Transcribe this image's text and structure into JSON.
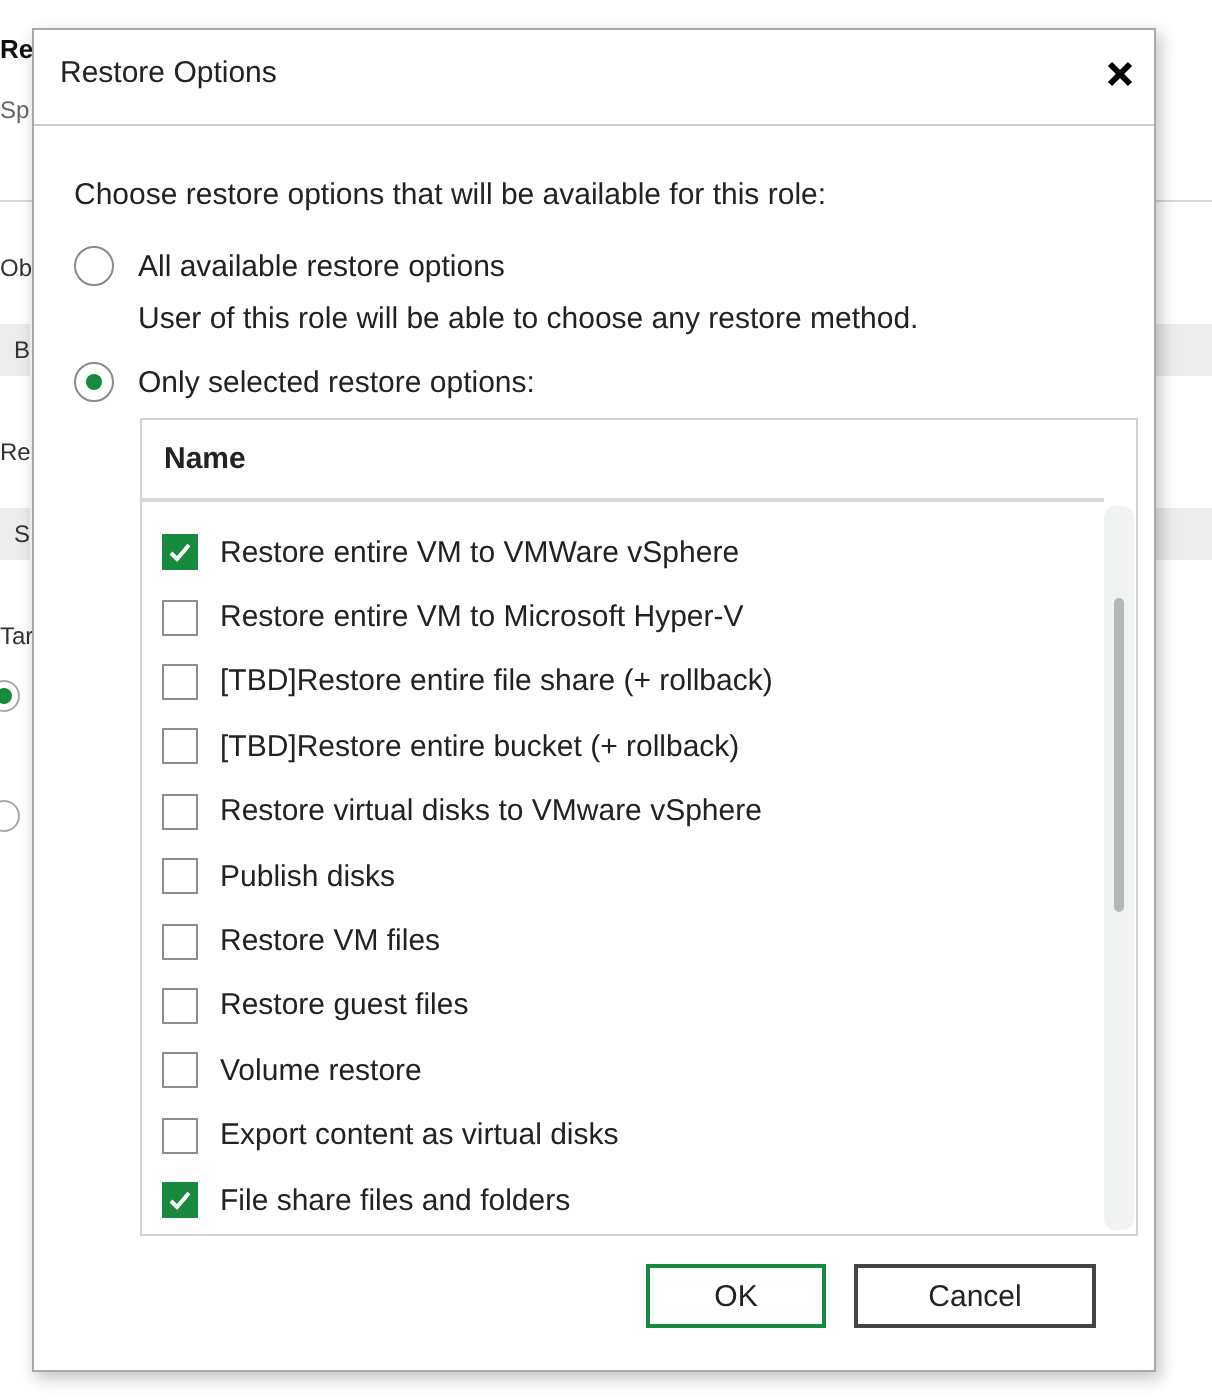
{
  "background": {
    "title": "Re",
    "subtitle": "Sp",
    "items": [
      {
        "kind": "label",
        "text": "Ob"
      },
      {
        "kind": "field",
        "value": "B"
      },
      {
        "kind": "label",
        "text": "Re"
      },
      {
        "kind": "field",
        "value": "S"
      },
      {
        "kind": "label",
        "text": "Tar"
      },
      {
        "kind": "radio",
        "selected": true
      },
      {
        "kind": "radio",
        "selected": false
      }
    ]
  },
  "dialog": {
    "title": "Restore Options",
    "prompt": "Choose restore options that will be available for this role:",
    "options": [
      {
        "label": "All available restore options",
        "description": "User of this role will be able to choose any restore method.",
        "selected": false
      },
      {
        "label": "Only selected restore options:",
        "selected": true
      }
    ],
    "list": {
      "column": "Name",
      "rows": [
        {
          "label": "Restore entire VM to VMWare vSphere",
          "checked": true
        },
        {
          "label": "Restore entire VM to Microsoft Hyper-V",
          "checked": false
        },
        {
          "label": "[TBD]Restore entire file share (+ rollback)",
          "checked": false
        },
        {
          "label": "[TBD]Restore entire bucket (+ rollback)",
          "checked": false
        },
        {
          "label": "Restore virtual disks to VMware vSphere",
          "checked": false
        },
        {
          "label": "Publish disks",
          "checked": false
        },
        {
          "label": "Restore VM files",
          "checked": false
        },
        {
          "label": "Restore guest files",
          "checked": false
        },
        {
          "label": "Volume restore",
          "checked": false
        },
        {
          "label": "Export content as virtual disks",
          "checked": false
        },
        {
          "label": "File share files and folders",
          "checked": true
        }
      ]
    },
    "buttons": [
      {
        "label": "OK",
        "default": true
      },
      {
        "label": "Cancel",
        "default": false
      }
    ]
  }
}
